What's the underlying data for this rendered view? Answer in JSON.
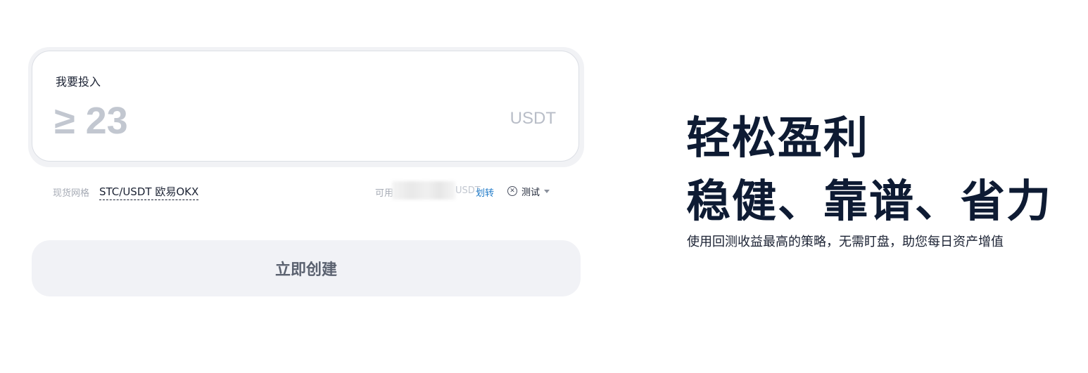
{
  "invest": {
    "label": "我要投入",
    "placeholder": "≥ 23",
    "value": "",
    "unit": "USDT"
  },
  "info": {
    "grid_type_label": "现货网格",
    "pair": "STC/USDT 欧易OKX",
    "available_label": "可用",
    "available_unit": "USDT",
    "transfer_label": "划转",
    "account_label": "测试"
  },
  "create_button_label": "立即创建",
  "promo": {
    "headline_1": "轻松盈利",
    "headline_2": "稳健、靠谱、省力",
    "subline": "使用回测收益最高的策略，无需盯盘，助您每日资产增值"
  },
  "colors": {
    "accent_link": "#1f7ac8",
    "headline": "#0e1b33",
    "button_bg": "#f1f2f6"
  }
}
